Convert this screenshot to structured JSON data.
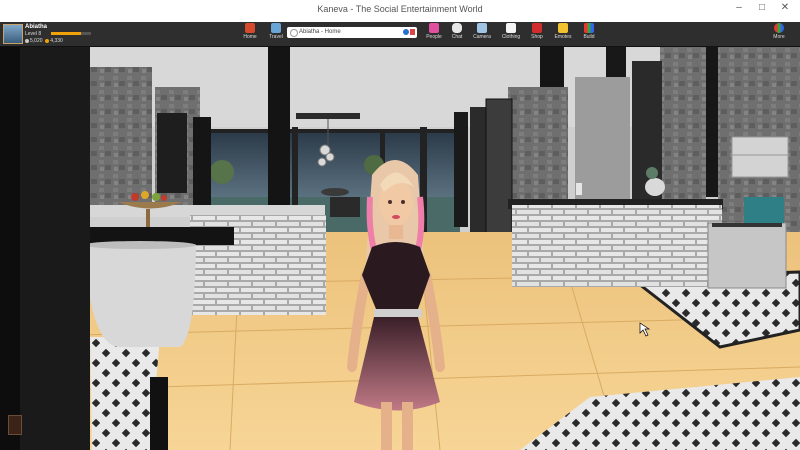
{
  "window": {
    "title": "Kaneva - The Social Entertainment World"
  },
  "user": {
    "name": "Abiatha",
    "level": "Level 8",
    "xp_fraction": 0.75,
    "credits": "5,020",
    "rewards": "4,330"
  },
  "nav": {
    "home": "Home",
    "travel": "Travel",
    "people": "People",
    "chat": "Chat",
    "camera": "Camera",
    "clothing": "Clothing",
    "shop": "Shop",
    "emotes": "Emotes",
    "build": "Build",
    "more": "More"
  },
  "url": {
    "text": "Abiatha  -  Home"
  },
  "colors": {
    "accent": "#f1a10a",
    "toolbar": "#2e2e2e",
    "floor": "#f3c77a"
  }
}
